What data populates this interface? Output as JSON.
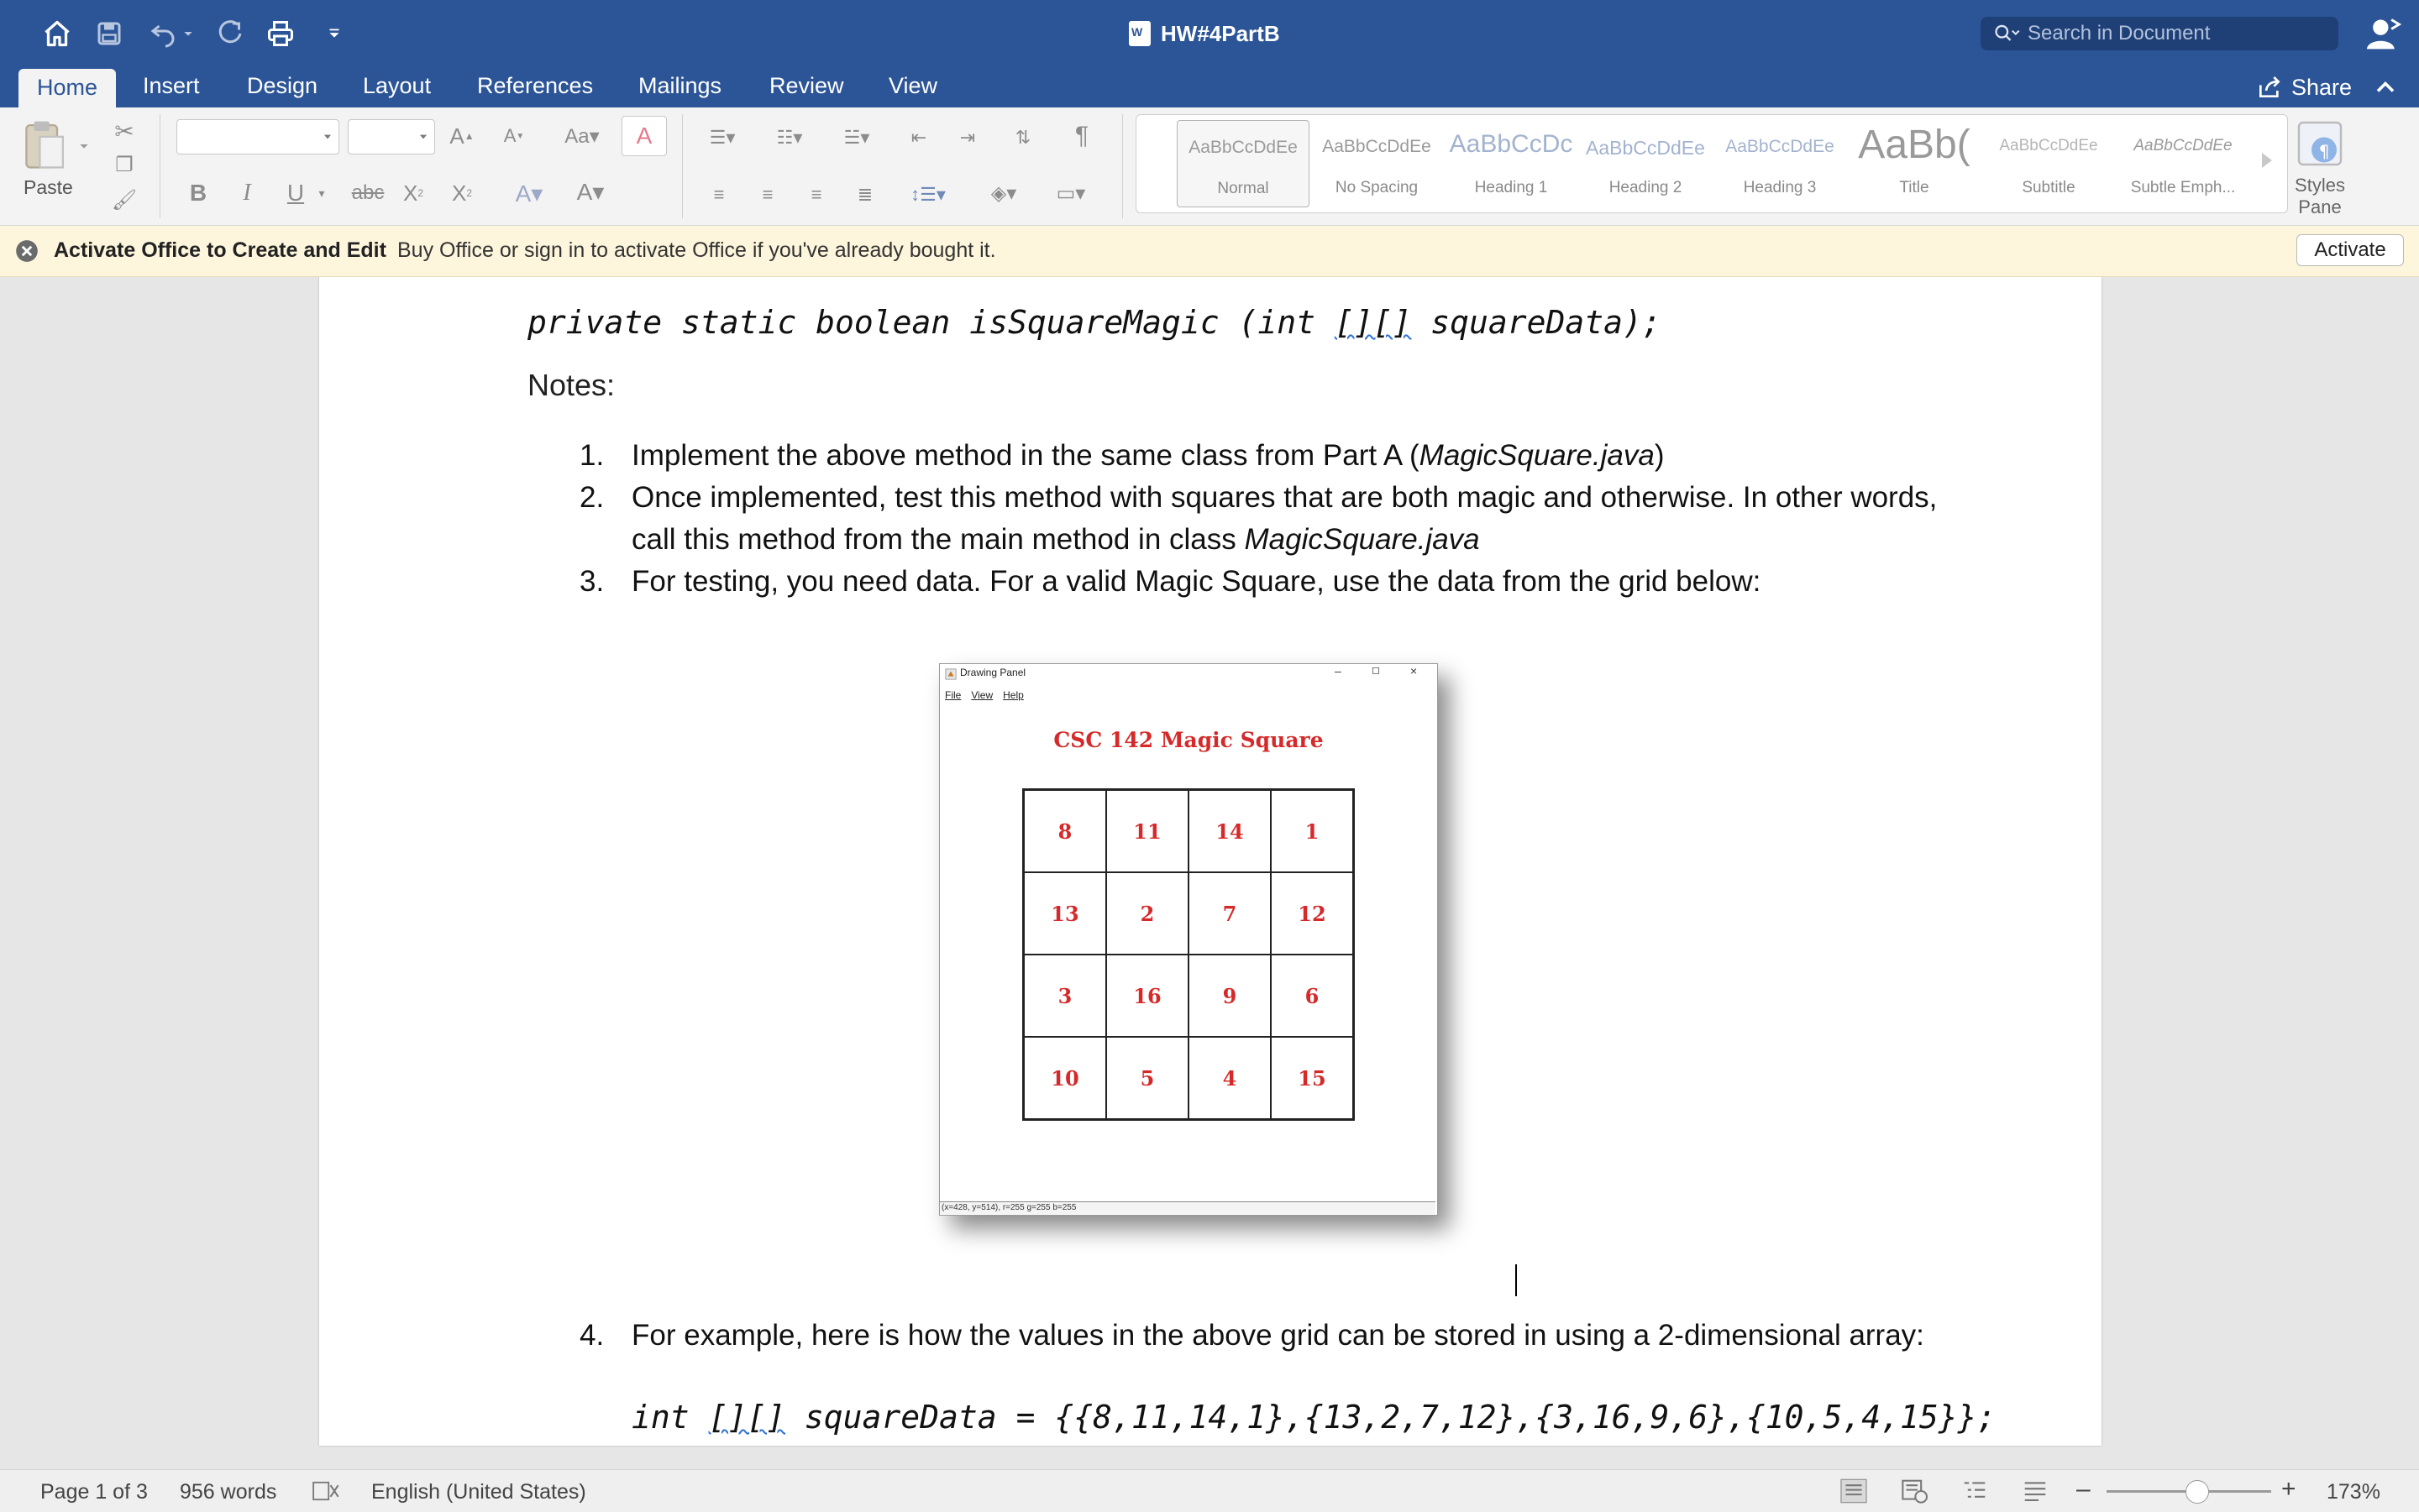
{
  "window": {
    "title": "HW#4PartB"
  },
  "search": {
    "placeholder": "Search in Document"
  },
  "tabs": [
    {
      "label": "Home",
      "active": true
    },
    {
      "label": "Insert"
    },
    {
      "label": "Design"
    },
    {
      "label": "Layout"
    },
    {
      "label": "References"
    },
    {
      "label": "Mailings"
    },
    {
      "label": "Review"
    },
    {
      "label": "View"
    }
  ],
  "share": {
    "label": "Share"
  },
  "ribbon": {
    "paste_label": "Paste",
    "styles": [
      {
        "sample": "AaBbCcDdEe",
        "name": "Normal"
      },
      {
        "sample": "AaBbCcDdEe",
        "name": "No Spacing"
      },
      {
        "sample": "AaBbCcDc",
        "name": "Heading 1"
      },
      {
        "sample": "AaBbCcDdEe",
        "name": "Heading 2"
      },
      {
        "sample": "AaBbCcDdEe",
        "name": "Heading 3"
      },
      {
        "sample": "AaBb(",
        "name": "Title"
      },
      {
        "sample": "AaBbCcDdEe",
        "name": "Subtitle"
      },
      {
        "sample": "AaBbCcDdEe",
        "name": "Subtle Emph..."
      }
    ],
    "styles_pane": {
      "line1": "Styles",
      "line2": "Pane"
    }
  },
  "activation": {
    "title": "Activate Office to Create and Edit",
    "message": "Buy Office or sign in to activate Office if you've already bought it.",
    "button": "Activate"
  },
  "document": {
    "signature": {
      "pre": "private static boolean isSquareMagic (int ",
      "brackets": "[][]",
      "post": " squareData);"
    },
    "notes_label": "Notes:",
    "item1": {
      "num": "1.",
      "text": "Implement the above method in the same class from Part A (",
      "italic": "MagicSquare.java",
      "end": ")"
    },
    "item2": {
      "num": "2.",
      "text": "Once implemented, test this method with squares that are both magic and otherwise. In other words, call this method from the main method in class ",
      "italic": "MagicSquare.java"
    },
    "item3": {
      "num": "3.",
      "text": "For testing, you need data. For a valid Magic Square, use the data from the grid below:"
    },
    "item4": {
      "num": "4.",
      "text": "For example, here is how the values in the above grid can be stored in using a 2-dimensional array:"
    },
    "code_array": {
      "pre": "int ",
      "brackets": "[][]",
      "post": " squareData = {{8,11,14,1},{13,2,7,12},{3,16,9,6},{10,5,4,15}};"
    }
  },
  "drawing_panel": {
    "window_title": "Drawing Panel",
    "menu": [
      "File",
      "View",
      "Help"
    ],
    "heading": "CSC 142 Magic Square",
    "grid": [
      [
        "8",
        "11",
        "14",
        "1"
      ],
      [
        "13",
        "2",
        "7",
        "12"
      ],
      [
        "3",
        "16",
        "9",
        "6"
      ],
      [
        "10",
        "5",
        "4",
        "15"
      ]
    ],
    "status": "(x=428, y=514), r=255 g=255 b=255"
  },
  "statusbar": {
    "page": "Page 1 of 3",
    "words": "956 words",
    "language": "English (United States)",
    "zoom": "173%"
  },
  "colors": {
    "accent": "#2c5597",
    "magic_text": "#d62a2a",
    "activation_bg": "#fdf6dc"
  }
}
